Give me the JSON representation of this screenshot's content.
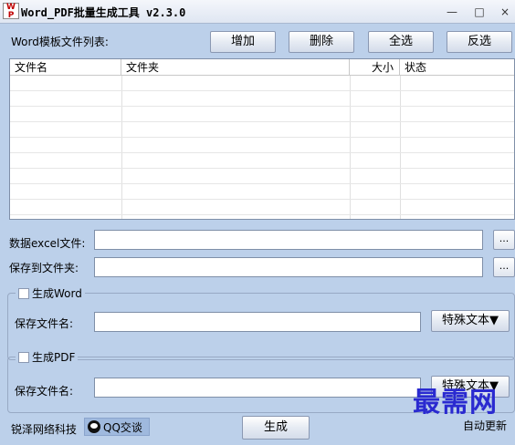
{
  "window": {
    "title": "Word_PDF批量生成工具 v2.3.0",
    "icon_text_top": "W",
    "icon_text_bottom": "P",
    "min_glyph": "—",
    "max_glyph": "□",
    "close_glyph": "×"
  },
  "template_list": {
    "label": "Word模板文件列表:",
    "buttons": {
      "add": "增加",
      "delete": "删除",
      "select_all": "全选",
      "invert": "反选"
    },
    "columns": [
      "文件名",
      "文件夹",
      "大小",
      "状态"
    ],
    "rows": []
  },
  "excel": {
    "label": "数据excel文件:",
    "value": "",
    "browse": "..."
  },
  "save_folder": {
    "label": "保存到文件夹:",
    "value": "",
    "browse": "..."
  },
  "word_group": {
    "checkbox_label": "生成Word",
    "checked": false,
    "filename_label": "保存文件名:",
    "filename_value": "",
    "special_text_button": "特殊文本▼"
  },
  "pdf_group": {
    "checkbox_label": "生成PDF",
    "checked": false,
    "filename_label": "保存文件名:",
    "filename_value": "",
    "special_text_button": "特殊文本▼"
  },
  "footer": {
    "company": "锐泽网络科技",
    "qq_label": "QQ交谈",
    "generate_button": "生成",
    "auto_update": "自动更新",
    "watermark": "最需网"
  }
}
